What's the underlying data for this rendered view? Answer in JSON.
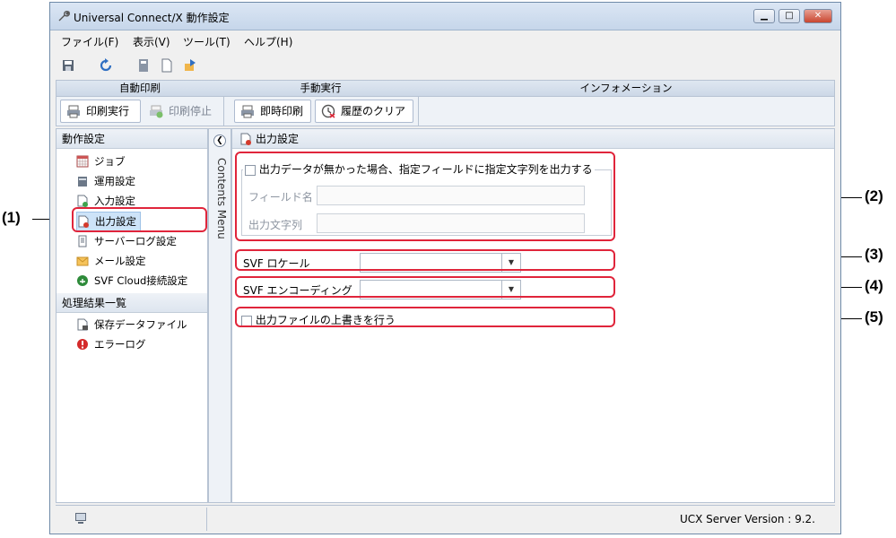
{
  "window": {
    "title": "Universal Connect/X 動作設定"
  },
  "menu": [
    "ファイル(F)",
    "表示(V)",
    "ツール(T)",
    "ヘルプ(H)"
  ],
  "ribbon": {
    "auto": {
      "header": "自動印刷",
      "run": "印刷実行",
      "stop": "印刷停止"
    },
    "manual": {
      "header": "手動実行",
      "immediate": "即時印刷",
      "clear": "履歴のクリア"
    },
    "info": {
      "header": "インフォメーション"
    }
  },
  "sidebar": {
    "section1": "動作設定",
    "items1": [
      "ジョブ",
      "運用設定",
      "入力設定",
      "出力設定",
      "サーバーログ設定",
      "メール設定",
      "SVF Cloud接続設定"
    ],
    "section2": "処理結果一覧",
    "items2": [
      "保存データファイル",
      "エラーログ"
    ]
  },
  "contents_menu": "Contents Menu",
  "content": {
    "title": "出力設定",
    "fieldset_check": "出力データが無かった場合、指定フィールドに指定文字列を出力する",
    "field_name_label": "フィールド名",
    "output_string_label": "出力文字列",
    "svf_locale_label": "SVF ロケール",
    "svf_encoding_label": "SVF エンコーディング",
    "overwrite_label": "出力ファイルの上書きを行う"
  },
  "status": {
    "version": "UCX Server Version : 9.2."
  },
  "callouts": [
    "(1)",
    "(2)",
    "(3)",
    "(4)",
    "(5)"
  ],
  "colors": {
    "highlight": "#e0253b",
    "selected": "#cde3f8"
  }
}
